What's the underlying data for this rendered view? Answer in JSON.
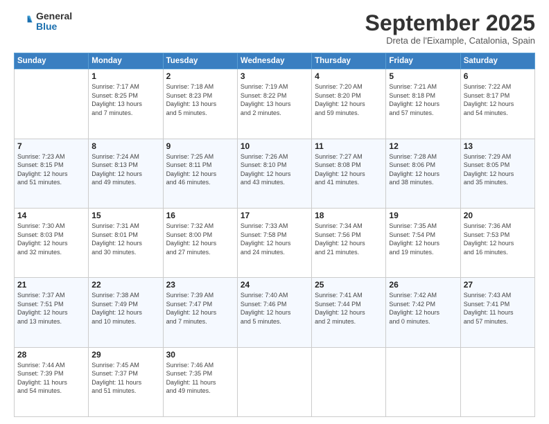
{
  "logo": {
    "general": "General",
    "blue": "Blue"
  },
  "header": {
    "month": "September 2025",
    "location": "Dreta de l'Eixample, Catalonia, Spain"
  },
  "weekdays": [
    "Sunday",
    "Monday",
    "Tuesday",
    "Wednesday",
    "Thursday",
    "Friday",
    "Saturday"
  ],
  "weeks": [
    [
      {
        "day": "",
        "info": ""
      },
      {
        "day": "1",
        "info": "Sunrise: 7:17 AM\nSunset: 8:25 PM\nDaylight: 13 hours\nand 7 minutes."
      },
      {
        "day": "2",
        "info": "Sunrise: 7:18 AM\nSunset: 8:23 PM\nDaylight: 13 hours\nand 5 minutes."
      },
      {
        "day": "3",
        "info": "Sunrise: 7:19 AM\nSunset: 8:22 PM\nDaylight: 13 hours\nand 2 minutes."
      },
      {
        "day": "4",
        "info": "Sunrise: 7:20 AM\nSunset: 8:20 PM\nDaylight: 12 hours\nand 59 minutes."
      },
      {
        "day": "5",
        "info": "Sunrise: 7:21 AM\nSunset: 8:18 PM\nDaylight: 12 hours\nand 57 minutes."
      },
      {
        "day": "6",
        "info": "Sunrise: 7:22 AM\nSunset: 8:17 PM\nDaylight: 12 hours\nand 54 minutes."
      }
    ],
    [
      {
        "day": "7",
        "info": "Sunrise: 7:23 AM\nSunset: 8:15 PM\nDaylight: 12 hours\nand 51 minutes."
      },
      {
        "day": "8",
        "info": "Sunrise: 7:24 AM\nSunset: 8:13 PM\nDaylight: 12 hours\nand 49 minutes."
      },
      {
        "day": "9",
        "info": "Sunrise: 7:25 AM\nSunset: 8:11 PM\nDaylight: 12 hours\nand 46 minutes."
      },
      {
        "day": "10",
        "info": "Sunrise: 7:26 AM\nSunset: 8:10 PM\nDaylight: 12 hours\nand 43 minutes."
      },
      {
        "day": "11",
        "info": "Sunrise: 7:27 AM\nSunset: 8:08 PM\nDaylight: 12 hours\nand 41 minutes."
      },
      {
        "day": "12",
        "info": "Sunrise: 7:28 AM\nSunset: 8:06 PM\nDaylight: 12 hours\nand 38 minutes."
      },
      {
        "day": "13",
        "info": "Sunrise: 7:29 AM\nSunset: 8:05 PM\nDaylight: 12 hours\nand 35 minutes."
      }
    ],
    [
      {
        "day": "14",
        "info": "Sunrise: 7:30 AM\nSunset: 8:03 PM\nDaylight: 12 hours\nand 32 minutes."
      },
      {
        "day": "15",
        "info": "Sunrise: 7:31 AM\nSunset: 8:01 PM\nDaylight: 12 hours\nand 30 minutes."
      },
      {
        "day": "16",
        "info": "Sunrise: 7:32 AM\nSunset: 8:00 PM\nDaylight: 12 hours\nand 27 minutes."
      },
      {
        "day": "17",
        "info": "Sunrise: 7:33 AM\nSunset: 7:58 PM\nDaylight: 12 hours\nand 24 minutes."
      },
      {
        "day": "18",
        "info": "Sunrise: 7:34 AM\nSunset: 7:56 PM\nDaylight: 12 hours\nand 21 minutes."
      },
      {
        "day": "19",
        "info": "Sunrise: 7:35 AM\nSunset: 7:54 PM\nDaylight: 12 hours\nand 19 minutes."
      },
      {
        "day": "20",
        "info": "Sunrise: 7:36 AM\nSunset: 7:53 PM\nDaylight: 12 hours\nand 16 minutes."
      }
    ],
    [
      {
        "day": "21",
        "info": "Sunrise: 7:37 AM\nSunset: 7:51 PM\nDaylight: 12 hours\nand 13 minutes."
      },
      {
        "day": "22",
        "info": "Sunrise: 7:38 AM\nSunset: 7:49 PM\nDaylight: 12 hours\nand 10 minutes."
      },
      {
        "day": "23",
        "info": "Sunrise: 7:39 AM\nSunset: 7:47 PM\nDaylight: 12 hours\nand 7 minutes."
      },
      {
        "day": "24",
        "info": "Sunrise: 7:40 AM\nSunset: 7:46 PM\nDaylight: 12 hours\nand 5 minutes."
      },
      {
        "day": "25",
        "info": "Sunrise: 7:41 AM\nSunset: 7:44 PM\nDaylight: 12 hours\nand 2 minutes."
      },
      {
        "day": "26",
        "info": "Sunrise: 7:42 AM\nSunset: 7:42 PM\nDaylight: 12 hours\nand 0 minutes."
      },
      {
        "day": "27",
        "info": "Sunrise: 7:43 AM\nSunset: 7:41 PM\nDaylight: 11 hours\nand 57 minutes."
      }
    ],
    [
      {
        "day": "28",
        "info": "Sunrise: 7:44 AM\nSunset: 7:39 PM\nDaylight: 11 hours\nand 54 minutes."
      },
      {
        "day": "29",
        "info": "Sunrise: 7:45 AM\nSunset: 7:37 PM\nDaylight: 11 hours\nand 51 minutes."
      },
      {
        "day": "30",
        "info": "Sunrise: 7:46 AM\nSunset: 7:35 PM\nDaylight: 11 hours\nand 49 minutes."
      },
      {
        "day": "",
        "info": ""
      },
      {
        "day": "",
        "info": ""
      },
      {
        "day": "",
        "info": ""
      },
      {
        "day": "",
        "info": ""
      }
    ]
  ]
}
